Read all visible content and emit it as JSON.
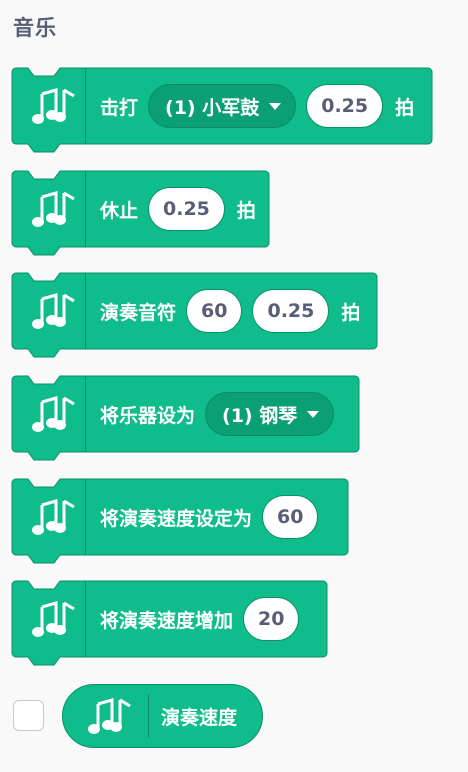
{
  "category": {
    "title": "音乐"
  },
  "colors": {
    "block": "#0fbd8c",
    "block_border": "#0b8e69",
    "dropdown": "#0b9f75",
    "title": "#575e75"
  },
  "blocks": [
    {
      "label": "击打",
      "dropdown": "(1) 小军鼓",
      "input": "0.25",
      "suffix": "拍"
    },
    {
      "label": "休止",
      "input": "0.25",
      "suffix": "拍"
    },
    {
      "label": "演奏音符",
      "input1": "60",
      "input2": "0.25",
      "suffix": "拍"
    },
    {
      "label": "将乐器设为",
      "dropdown": "(1) 钢琴"
    },
    {
      "label": "将演奏速度设定为",
      "input": "60"
    },
    {
      "label": "将演奏速度增加",
      "input": "20"
    }
  ],
  "reporter": {
    "label": "演奏速度",
    "checked": false
  },
  "icons": {
    "block_icon": "music-notes-icon"
  }
}
